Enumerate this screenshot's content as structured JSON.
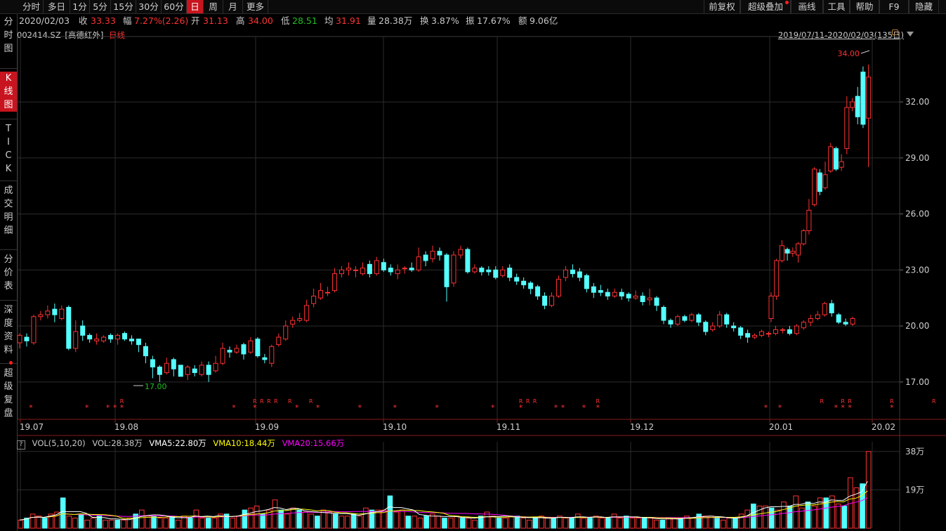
{
  "toolbar": {
    "left": [
      "分时",
      "多日",
      "1分",
      "5分",
      "15分",
      "30分",
      "60分",
      "日",
      "周",
      "月",
      "更多"
    ],
    "active": "日",
    "right": [
      "前复权",
      "超级叠加",
      "画线",
      "工具",
      "帮助",
      "F9",
      "隐藏"
    ]
  },
  "info": {
    "date": "2020/02/03",
    "close_label": "收",
    "close": "33.33",
    "change_label": "幅",
    "change": "7.27%(2.26)",
    "open_label": "开",
    "open": "31.13",
    "high_label": "高",
    "high": "34.00",
    "low_label": "低",
    "low": "28.51",
    "avg_label": "均",
    "avg": "31.91",
    "volume_label": "量",
    "volume": "28.38万",
    "turnover_label": "换",
    "turnover": "3.87%",
    "amplitude_label": "振",
    "amplitude": "17.67%",
    "amount_label": "额",
    "amount": "9.06亿"
  },
  "sidebar": {
    "tabs": [
      "分时图",
      "K线图",
      "TICK",
      "成交明细",
      "分价表",
      "深度资料",
      "超级复盘"
    ],
    "active": "K线图"
  },
  "chart_header": {
    "symbol": "002414.SZ",
    "name": "[高德红外]",
    "period": "日线",
    "range": "2019/07/11-2020/02/03(135日)"
  },
  "colors": {
    "up": "#ff3232",
    "down": "#54ffff",
    "grid": "#2c2c2c",
    "vma5": "#ffffff",
    "vma10": "#ffff00",
    "vma20": "#ff00ff",
    "low_label": "#20c020"
  },
  "volume_header": {
    "indicator": "VOL(5,10,20)",
    "vol": "VOL:28.38万",
    "vma5": "VMA5:22.80万",
    "vma10": "VMA10:18.44万",
    "vma20": "VMA20:15.66万"
  },
  "chart_data": {
    "type": "candlestick",
    "price_ticks": [
      "32.00",
      "29.00",
      "26.00",
      "23.00",
      "20.00",
      "17.00"
    ],
    "volume_ticks": [
      "38万",
      "19万"
    ],
    "x_ticks": [
      "19.07",
      "19.08",
      "19.09",
      "19.10",
      "19.11",
      "19.12",
      "20.01",
      "20.02"
    ],
    "high_marker": "34.00",
    "low_marker": "17.00",
    "ylim": [
      15.0,
      35.2
    ],
    "vol_ylim": [
      0,
      40
    ],
    "candles_ohlc": [
      [
        19.1,
        19.5,
        18.8,
        19.6
      ],
      [
        19.4,
        19.2,
        18.9,
        19.6
      ],
      [
        19.1,
        20.5,
        19.0,
        20.6
      ],
      [
        20.5,
        20.6,
        20.3,
        20.8
      ],
      [
        20.6,
        20.8,
        20.4,
        21.1
      ],
      [
        20.9,
        20.6,
        20.2,
        21.2
      ],
      [
        20.4,
        20.9,
        20.3,
        21.1
      ],
      [
        21.0,
        18.8,
        18.7,
        21.1
      ],
      [
        18.8,
        19.7,
        18.6,
        20.3
      ],
      [
        20.0,
        19.5,
        19.2,
        20.3
      ],
      [
        19.5,
        19.3,
        19.1,
        19.6
      ],
      [
        19.2,
        19.3,
        19.0,
        19.6
      ],
      [
        19.2,
        19.4,
        19.1,
        19.5
      ],
      [
        19.5,
        19.3,
        19.1,
        19.6
      ],
      [
        19.3,
        19.5,
        19.0,
        19.6
      ],
      [
        19.6,
        19.3,
        19.2,
        19.7
      ],
      [
        19.3,
        19.2,
        19.0,
        19.5
      ],
      [
        19.3,
        19.0,
        18.6,
        19.3
      ],
      [
        18.9,
        18.4,
        18.0,
        19.1
      ],
      [
        18.2,
        17.8,
        17.2,
        18.4
      ],
      [
        17.8,
        17.4,
        17.0,
        17.9
      ],
      [
        17.5,
        18.0,
        17.4,
        18.3
      ],
      [
        18.2,
        17.7,
        17.3,
        18.3
      ],
      [
        17.9,
        17.3,
        17.3,
        17.9
      ],
      [
        17.4,
        17.8,
        17.1,
        17.9
      ],
      [
        17.7,
        17.5,
        17.3,
        17.9
      ],
      [
        17.4,
        17.9,
        17.3,
        18.1
      ],
      [
        17.9,
        17.4,
        17.0,
        18.1
      ],
      [
        17.6,
        18.0,
        17.5,
        18.4
      ],
      [
        18.0,
        18.8,
        17.9,
        19.1
      ],
      [
        18.7,
        18.6,
        18.3,
        18.9
      ],
      [
        18.6,
        18.8,
        18.5,
        19.0
      ],
      [
        19.0,
        18.5,
        18.2,
        19.1
      ],
      [
        18.6,
        19.2,
        18.5,
        19.4
      ],
      [
        19.3,
        18.4,
        18.3,
        19.4
      ],
      [
        18.3,
        18.2,
        18.0,
        18.5
      ],
      [
        18.0,
        18.9,
        17.8,
        19.0
      ],
      [
        19.0,
        19.4,
        18.9,
        19.6
      ],
      [
        19.3,
        20.0,
        19.2,
        20.3
      ],
      [
        20.1,
        20.3,
        19.9,
        20.5
      ],
      [
        20.3,
        20.4,
        20.2,
        20.7
      ],
      [
        20.3,
        21.1,
        20.2,
        21.4
      ],
      [
        21.2,
        21.6,
        21.0,
        22.0
      ],
      [
        21.5,
        21.9,
        21.4,
        22.3
      ],
      [
        21.8,
        21.8,
        21.6,
        22.1
      ],
      [
        21.9,
        22.8,
        21.8,
        23.1
      ],
      [
        22.8,
        23.0,
        22.6,
        23.2
      ],
      [
        23.0,
        23.1,
        22.7,
        23.4
      ],
      [
        23.0,
        23.0,
        22.6,
        23.2
      ],
      [
        22.8,
        23.1,
        22.7,
        23.4
      ],
      [
        23.3,
        22.8,
        22.6,
        23.5
      ],
      [
        22.8,
        23.5,
        22.7,
        23.7
      ],
      [
        23.4,
        23.0,
        22.9,
        23.6
      ],
      [
        23.1,
        22.9,
        22.7,
        23.3
      ],
      [
        22.8,
        23.0,
        22.5,
        23.3
      ],
      [
        23.1,
        23.1,
        22.8,
        23.2
      ],
      [
        23.1,
        23.0,
        22.9,
        23.4
      ],
      [
        23.0,
        23.7,
        22.9,
        24.2
      ],
      [
        23.8,
        23.5,
        23.2,
        24.0
      ],
      [
        23.6,
        24.0,
        23.4,
        24.3
      ],
      [
        24.0,
        23.8,
        23.5,
        24.2
      ],
      [
        23.8,
        22.1,
        21.3,
        23.9
      ],
      [
        22.3,
        23.8,
        22.1,
        24.0
      ],
      [
        23.8,
        24.1,
        23.6,
        24.3
      ],
      [
        24.1,
        22.9,
        22.8,
        24.2
      ],
      [
        22.9,
        23.1,
        22.8,
        23.3
      ],
      [
        23.1,
        22.9,
        22.7,
        23.2
      ],
      [
        23.0,
        22.9,
        22.7,
        23.2
      ],
      [
        23.0,
        22.6,
        22.5,
        23.2
      ],
      [
        22.7,
        23.0,
        22.6,
        23.2
      ],
      [
        23.1,
        22.6,
        22.4,
        23.3
      ],
      [
        22.6,
        22.4,
        22.2,
        22.8
      ],
      [
        22.4,
        22.2,
        22.0,
        22.6
      ],
      [
        22.3,
        22.0,
        21.7,
        22.4
      ],
      [
        22.1,
        21.6,
        21.4,
        22.2
      ],
      [
        21.6,
        21.1,
        20.9,
        21.8
      ],
      [
        21.1,
        21.6,
        21.0,
        21.8
      ],
      [
        21.6,
        22.5,
        21.5,
        22.7
      ],
      [
        22.6,
        23.0,
        22.4,
        23.2
      ],
      [
        23.0,
        22.8,
        22.6,
        23.3
      ],
      [
        22.9,
        22.6,
        22.4,
        23.1
      ],
      [
        22.7,
        22.0,
        21.8,
        22.8
      ],
      [
        22.1,
        21.8,
        21.5,
        22.3
      ],
      [
        21.9,
        21.8,
        21.6,
        22.2
      ],
      [
        21.8,
        21.6,
        21.4,
        22.0
      ],
      [
        21.6,
        21.8,
        21.5,
        22.0
      ],
      [
        21.8,
        21.6,
        21.4,
        22.0
      ],
      [
        21.7,
        21.5,
        21.3,
        21.8
      ],
      [
        21.5,
        21.6,
        21.4,
        21.9
      ],
      [
        21.6,
        21.3,
        21.1,
        21.8
      ],
      [
        21.4,
        21.5,
        21.1,
        22.0
      ],
      [
        21.5,
        21.1,
        20.8,
        21.6
      ],
      [
        21.0,
        20.3,
        20.1,
        21.1
      ],
      [
        20.3,
        20.1,
        19.9,
        20.4
      ],
      [
        20.1,
        20.5,
        20.0,
        20.6
      ],
      [
        20.5,
        20.3,
        20.2,
        20.6
      ],
      [
        20.3,
        20.6,
        20.2,
        20.7
      ],
      [
        20.6,
        20.2,
        20.0,
        20.7
      ],
      [
        20.2,
        19.7,
        19.5,
        20.3
      ],
      [
        19.8,
        20.0,
        19.7,
        20.2
      ],
      [
        20.0,
        20.6,
        19.9,
        20.8
      ],
      [
        20.6,
        20.1,
        19.9,
        20.7
      ],
      [
        20.0,
        19.9,
        19.7,
        20.2
      ],
      [
        19.9,
        19.5,
        19.3,
        20.0
      ],
      [
        19.6,
        19.4,
        19.1,
        19.8
      ],
      [
        19.4,
        19.5,
        19.3,
        19.6
      ],
      [
        19.5,
        19.7,
        19.4,
        19.8
      ],
      [
        19.6,
        19.6,
        19.4,
        19.7
      ],
      [
        19.6,
        19.8,
        19.5,
        20.0
      ],
      [
        19.8,
        19.8,
        19.6,
        19.9
      ],
      [
        19.8,
        19.6,
        19.5,
        20.0
      ],
      [
        19.6,
        20.0,
        19.5,
        20.1
      ],
      [
        19.9,
        20.2,
        19.8,
        20.3
      ],
      [
        20.2,
        20.4,
        20.0,
        20.6
      ],
      [
        20.4,
        20.6,
        20.3,
        20.8
      ],
      [
        20.6,
        21.2,
        20.5,
        21.3
      ],
      [
        21.2,
        20.7,
        20.5,
        21.4
      ],
      [
        20.6,
        20.2,
        20.1,
        20.7
      ],
      [
        20.2,
        20.1,
        20.0,
        20.4
      ],
      [
        20.1,
        20.4,
        20.0,
        20.5
      ]
    ],
    "volumes_wan": [
      4,
      5,
      7,
      6,
      5,
      7,
      8,
      15,
      6,
      5,
      7,
      4,
      5,
      6,
      4,
      4,
      4,
      4,
      5,
      7,
      9,
      6,
      6,
      5,
      5,
      6,
      4,
      6,
      5,
      9,
      5,
      5,
      5,
      7,
      7,
      5,
      6,
      9,
      10,
      11,
      7,
      9,
      14,
      9,
      7,
      10,
      9,
      8,
      7,
      6,
      9,
      8,
      7,
      6,
      6,
      7,
      6,
      10,
      9,
      9,
      9,
      16,
      8,
      9,
      6,
      6,
      5,
      6,
      7,
      6,
      5,
      5,
      6,
      5,
      5,
      4,
      6,
      8,
      6,
      5,
      5,
      6,
      6,
      5,
      4,
      5,
      6,
      5,
      5,
      6,
      5,
      5,
      7,
      5,
      5,
      6,
      5,
      5,
      7,
      5,
      6,
      5,
      5,
      5,
      5,
      4,
      4,
      5,
      5,
      5,
      6,
      5,
      7,
      6,
      6,
      5,
      4,
      5,
      5,
      7,
      9,
      12,
      11,
      11,
      10,
      9,
      13,
      11,
      16,
      10,
      13,
      11,
      15,
      15,
      16,
      12,
      11,
      25,
      20,
      22,
      38
    ],
    "signal_markers": {
      "stars": [
        1,
        9,
        12,
        13,
        14,
        30,
        33,
        39,
        42,
        48,
        53,
        59,
        67,
        71,
        76,
        77,
        80,
        82,
        106,
        108,
        116,
        117,
        118,
        124,
        132,
        136
      ],
      "rs": [
        14,
        33,
        34,
        35,
        36,
        38,
        41,
        71,
        72,
        73,
        82,
        114,
        117,
        118,
        124,
        130
      ]
    }
  }
}
